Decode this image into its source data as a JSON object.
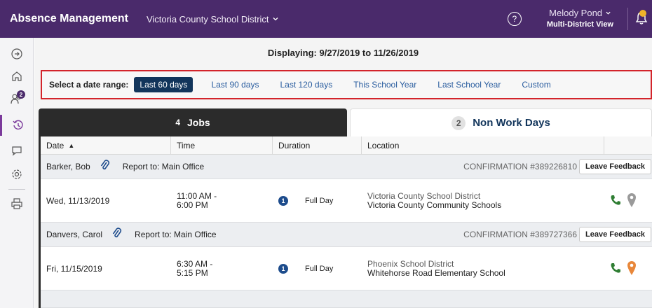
{
  "header": {
    "app_title": "Absence Management",
    "district": "Victoria County School District",
    "user_name": "Melody Pond",
    "user_view": "Multi-District View",
    "help": "?"
  },
  "rail": {
    "badge_count": "2"
  },
  "displaying": "Displaying: 9/27/2019  to  11/26/2019",
  "date_range": {
    "label": "Select a date range:",
    "options": [
      "Last 60 days",
      "Last 90 days",
      "Last 120 days",
      "This School Year",
      "Last School Year",
      "Custom"
    ],
    "selected": "Last 60 days"
  },
  "tabs": {
    "jobs": {
      "count": "4",
      "label": "Jobs"
    },
    "non_work": {
      "count": "2",
      "label": "Non Work Days"
    }
  },
  "table": {
    "columns": [
      "Date",
      "Time",
      "Duration",
      "Location"
    ],
    "sort_indicator": "▲",
    "groups": [
      {
        "name": "Barker, Bob",
        "report": "Report to: Main Office",
        "confirmation": "CONFIRMATION #389226810",
        "feedback_label": "Leave Feedback",
        "date": "Wed, 11/13/2019",
        "time_start": "11:00 AM -",
        "time_end": "6:00 PM",
        "duration_icon": "1",
        "duration": "Full Day",
        "loc_district": "Victoria County School District",
        "loc_school": "Victoria County Community Schools",
        "pin_color": "#9a9a9a"
      },
      {
        "name": "Danvers, Carol",
        "report": "Report to: Main Office",
        "confirmation": "CONFIRMATION #389727366",
        "feedback_label": "Leave Feedback",
        "date": "Fri, 11/15/2019",
        "time_start": "6:30 AM -",
        "time_end": "5:15 PM",
        "duration_icon": "1",
        "duration": "Full Day",
        "loc_district": "Phoenix School District",
        "loc_school": "Whitehorse Road Elementary School",
        "pin_color": "#e8873a"
      }
    ]
  },
  "colors": {
    "header": "#4a2a6b",
    "accent": "#7b3a9b",
    "highlight_border": "#d3242b",
    "phone": "#2e7d32"
  }
}
